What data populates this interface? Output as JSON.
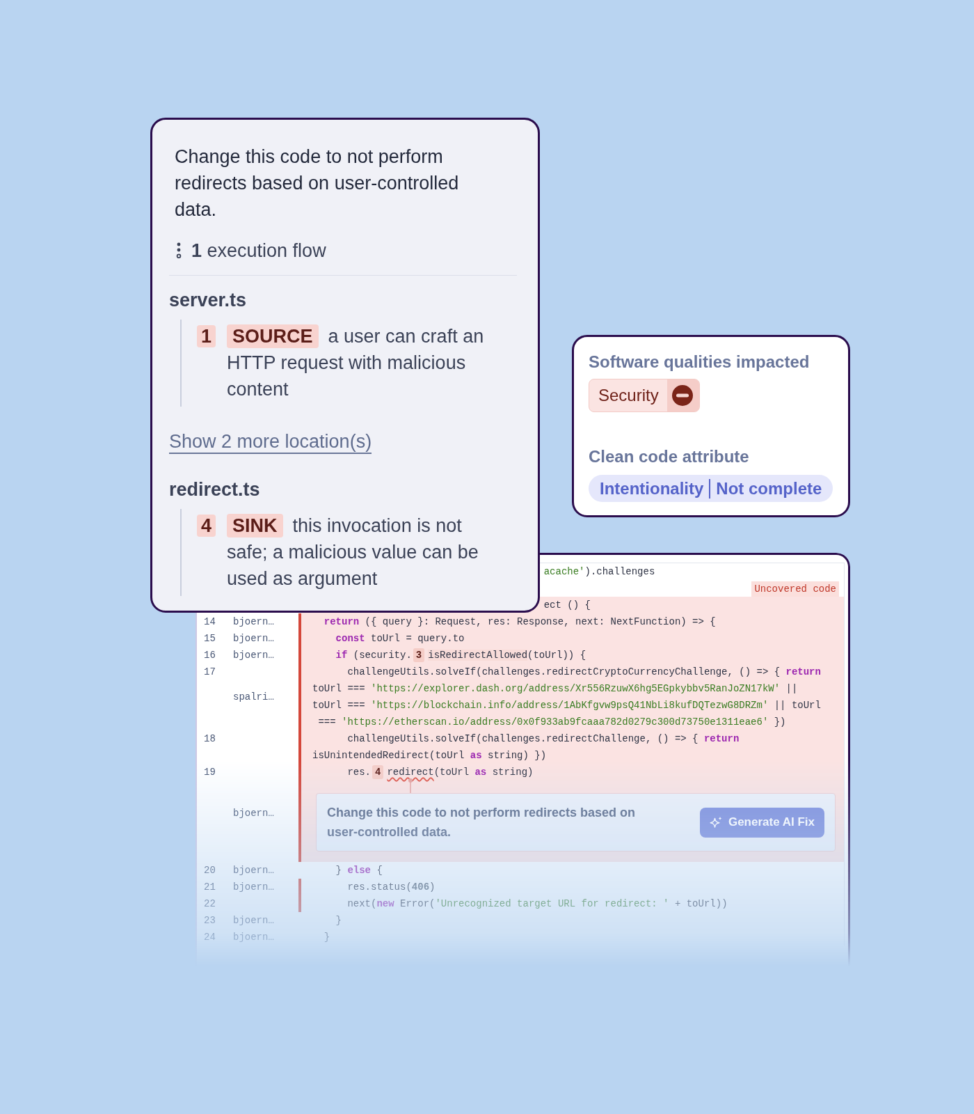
{
  "issue_card": {
    "message": "Change this code to not perform redirects based on user-controlled data.",
    "flow": "**1** execution flow",
    "sections": [
      {
        "kind": "file",
        "name": "server.ts",
        "steps": [
          {
            "number": "1",
            "tag": "SOURCE",
            "text": "a user can craft an HTTP request with malicious content"
          }
        ]
      },
      {
        "kind": "link",
        "label": "Show 2 more location(s)"
      },
      {
        "kind": "file",
        "name": "redirect.ts",
        "steps": [
          {
            "number": "4",
            "tag": "SINK",
            "text": "this invocation is not safe; a malicious value can be used as argument"
          }
        ]
      }
    ]
  },
  "qualities_card": {
    "title": "Software qualities impacted",
    "qualities": [
      {
        "label": "Security"
      }
    ],
    "attribute_title": "Clean code attribute",
    "attribute": {
      "category": "Intentionality",
      "value": "Not complete"
    }
  },
  "code_view": {
    "rows": [
      {
        "kind": "clipped",
        "lines": [
          [
            {
              "text": "acache'",
              "kind": "string"
            },
            {
              "text": ").challenges",
              "kind": "plain"
            }
          ]
        ]
      },
      {
        "kind": "label",
        "text": "Uncovered code"
      },
      {
        "kind": "clipped",
        "highlighted": true,
        "lines": [
          [
            {
              "text": "ect () {",
              "kind": "plain"
            }
          ]
        ]
      },
      {
        "kind": "code",
        "number": "14",
        "author": "bjoern…",
        "highlighted": true,
        "uncovered": true,
        "lines": [
          [
            {
              "text": "  return",
              "kind": "keyword"
            },
            {
              "text": " ({ query }: Request, res: Response, next: NextFunction) => {",
              "kind": "plain"
            }
          ]
        ]
      },
      {
        "kind": "code",
        "number": "15",
        "author": "bjoern…",
        "highlighted": true,
        "uncovered": true,
        "lines": [
          [
            {
              "text": "    const",
              "kind": "keyword"
            },
            {
              "text": " toUrl = query.to",
              "kind": "plain"
            }
          ]
        ]
      },
      {
        "kind": "code",
        "number": "16",
        "author": "bjoern…",
        "highlighted": true,
        "uncovered": true,
        "lines": [
          [
            {
              "text": "    if",
              "kind": "keyword"
            },
            {
              "text": " (security.",
              "kind": "plain"
            },
            {
              "text": "3",
              "kind": "marker"
            },
            {
              "text": "isRedirectAllowed",
              "kind": "location"
            },
            {
              "text": "(toUrl)) {",
              "kind": "plain"
            }
          ]
        ]
      },
      {
        "kind": "code",
        "number": "17",
        "author": "spalri…",
        "highlighted": true,
        "uncovered": true,
        "lines": [
          [
            {
              "text": "      challengeUtils.solveIf(challenges.redirectCryptoCurrencyChallenge, () => { ",
              "kind": "plain"
            },
            {
              "text": "return",
              "kind": "keyword"
            }
          ],
          [
            {
              "text": "toUrl === ",
              "kind": "plain"
            },
            {
              "text": "'https://explorer.dash.org/address/Xr556RzuwX6hg5EGpkybbv5RanJoZN17kW'",
              "kind": "string"
            },
            {
              "text": " ||",
              "kind": "plain"
            }
          ],
          [
            {
              "text": "toUrl === ",
              "kind": "plain"
            },
            {
              "text": "'https://blockchain.info/address/1AbKfgvw9psQ41NbLi8kufDQTezwG8DRZm'",
              "kind": "string"
            },
            {
              "text": " || toUrl",
              "kind": "plain"
            }
          ],
          [
            {
              "text": " === ",
              "kind": "plain"
            },
            {
              "text": "'https://etherscan.io/address/0x0f933ab9fcaaa782d0279c300d73750e1311eae6'",
              "kind": "string"
            },
            {
              "text": " })",
              "kind": "plain"
            }
          ]
        ]
      },
      {
        "kind": "code",
        "number": "18",
        "highlighted": true,
        "uncovered": true,
        "lines": [
          [
            {
              "text": "      challengeUtils.solveIf(challenges.redirectChallenge, () => { ",
              "kind": "plain"
            },
            {
              "text": "return",
              "kind": "keyword"
            }
          ],
          [
            {
              "text": "isUnintendedRedirect(toUrl ",
              "kind": "plain"
            },
            {
              "text": "as",
              "kind": "keyword"
            },
            {
              "text": " string) })",
              "kind": "plain"
            }
          ]
        ]
      },
      {
        "kind": "code",
        "number": "19",
        "author": "bjoern…",
        "highlighted": true,
        "uncovered": true,
        "lines": [
          [
            {
              "text": "      res.",
              "kind": "plain"
            },
            {
              "text": "4",
              "kind": "marker"
            },
            {
              "text": "redirect",
              "kind": "flagged"
            },
            {
              "text": "(toUrl ",
              "kind": "plain"
            },
            {
              "text": "as",
              "kind": "keyword"
            },
            {
              "text": " string)",
              "kind": "plain"
            }
          ]
        ],
        "issue": {
          "message": "Change this code to not perform redirects based on user-controlled data.",
          "button": "Generate AI Fix"
        }
      },
      {
        "kind": "code",
        "number": "20",
        "author": "bjoern…",
        "lines": [
          [
            {
              "text": "    } ",
              "kind": "plain"
            },
            {
              "text": "else",
              "kind": "keyword"
            },
            {
              "text": " {",
              "kind": "plain"
            }
          ]
        ]
      },
      {
        "kind": "code",
        "number": "21",
        "author": "bjoern…",
        "uncovered": true,
        "lines": [
          [
            {
              "text": "      res.status(",
              "kind": "plain"
            },
            {
              "text": "406",
              "kind": "number"
            },
            {
              "text": ")",
              "kind": "plain"
            }
          ]
        ]
      },
      {
        "kind": "code",
        "number": "22",
        "uncovered": true,
        "lines": [
          [
            {
              "text": "      next(",
              "kind": "plain"
            },
            {
              "text": "new",
              "kind": "keyword"
            },
            {
              "text": " Error(",
              "kind": "plain"
            },
            {
              "text": "'Unrecognized target URL for redirect: '",
              "kind": "string"
            },
            {
              "text": " + toUrl))",
              "kind": "plain"
            }
          ]
        ]
      },
      {
        "kind": "code",
        "number": "23",
        "author": "bjoern…",
        "lines": [
          [
            {
              "text": "    }",
              "kind": "plain"
            }
          ]
        ]
      },
      {
        "kind": "code",
        "number": "24",
        "author": "bjoern…",
        "lines": [
          [
            {
              "text": "  }",
              "kind": "plain"
            }
          ]
        ]
      }
    ]
  }
}
